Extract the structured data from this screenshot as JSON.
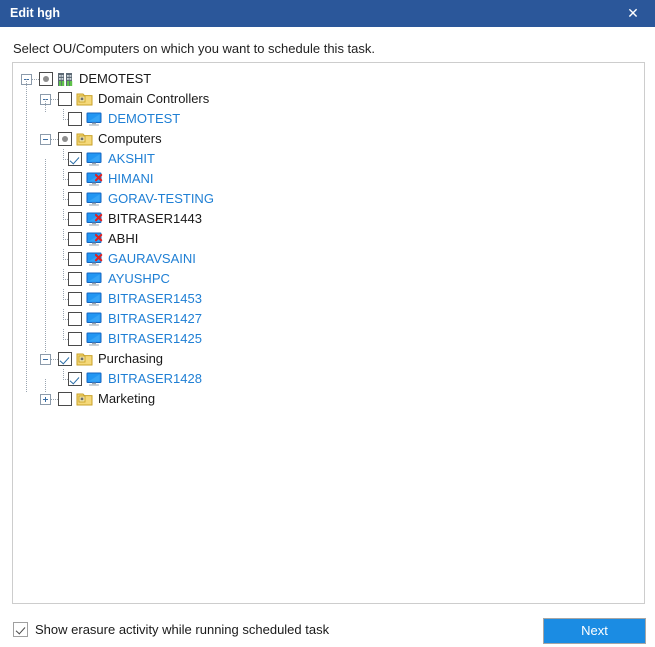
{
  "window": {
    "title": "Edit hgh",
    "close_label": "✕",
    "titlebar_color": "#2b579a"
  },
  "instruction": "Select OU/Computers on which you want to schedule this task.",
  "tree": {
    "nodes": [
      {
        "label": "DEMOTEST",
        "level": 0,
        "icon": "building-icon",
        "state": "partial",
        "expander": "minus",
        "color": "black",
        "last": false
      },
      {
        "label": "Domain Controllers",
        "level": 1,
        "icon": "folder-icon",
        "state": "unchecked",
        "expander": "minus",
        "color": "black",
        "last": false
      },
      {
        "label": "DEMOTEST",
        "level": 2,
        "icon": "monitor-icon",
        "state": "unchecked",
        "expander": "none",
        "color": "blue",
        "last": true
      },
      {
        "label": "Computers",
        "level": 1,
        "icon": "folder-icon",
        "state": "partial",
        "expander": "minus",
        "color": "black",
        "last": false
      },
      {
        "label": "AKSHIT",
        "level": 2,
        "icon": "monitor-icon",
        "state": "checked",
        "expander": "none",
        "color": "blue",
        "last": false
      },
      {
        "label": "HIMANI",
        "level": 2,
        "icon": "monitor-error-icon",
        "state": "unchecked",
        "expander": "none",
        "color": "blue",
        "last": false
      },
      {
        "label": "GORAV-TESTING",
        "level": 2,
        "icon": "monitor-icon",
        "state": "unchecked",
        "expander": "none",
        "color": "blue",
        "last": false
      },
      {
        "label": "BITRASER1443",
        "level": 2,
        "icon": "monitor-error-icon",
        "state": "unchecked",
        "expander": "none",
        "color": "black",
        "last": false
      },
      {
        "label": "ABHI",
        "level": 2,
        "icon": "monitor-error-icon",
        "state": "unchecked",
        "expander": "none",
        "color": "black",
        "last": false
      },
      {
        "label": "GAURAVSAINI",
        "level": 2,
        "icon": "monitor-error-icon",
        "state": "unchecked",
        "expander": "none",
        "color": "blue",
        "last": false
      },
      {
        "label": "AYUSHPC",
        "level": 2,
        "icon": "monitor-icon",
        "state": "unchecked",
        "expander": "none",
        "color": "blue",
        "last": false
      },
      {
        "label": "BITRASER1453",
        "level": 2,
        "icon": "monitor-icon",
        "state": "unchecked",
        "expander": "none",
        "color": "blue",
        "last": false
      },
      {
        "label": "BITRASER1427",
        "level": 2,
        "icon": "monitor-icon",
        "state": "unchecked",
        "expander": "none",
        "color": "blue",
        "last": false
      },
      {
        "label": "BITRASER1425",
        "level": 2,
        "icon": "monitor-icon",
        "state": "unchecked",
        "expander": "none",
        "color": "blue",
        "last": true
      },
      {
        "label": "Purchasing",
        "level": 1,
        "icon": "folder-icon",
        "state": "checked",
        "expander": "minus",
        "color": "black",
        "last": false
      },
      {
        "label": "BITRASER1428",
        "level": 2,
        "icon": "monitor-icon",
        "state": "checked",
        "expander": "none",
        "color": "blue",
        "last": true
      },
      {
        "label": "Marketing",
        "level": 1,
        "icon": "folder-icon",
        "state": "unchecked",
        "expander": "plus",
        "color": "black",
        "last": true
      }
    ]
  },
  "footer": {
    "checkbox_label": "Show erasure activity while running scheduled task",
    "checkbox_checked": true,
    "next_label": "Next",
    "next_color": "#1b8ce3"
  }
}
